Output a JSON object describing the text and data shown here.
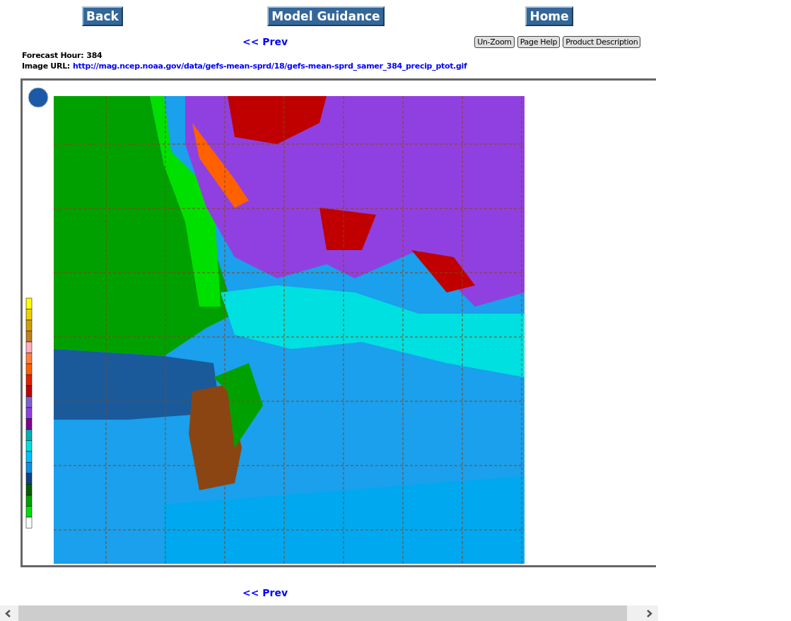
{
  "nav_buttons": [
    {
      "label": "Back"
    },
    {
      "label": "Model Guidance"
    },
    {
      "label": "Home"
    }
  ],
  "prev_link_top": "<< Prev",
  "tool_buttons": [
    {
      "label": "Un-Zoom"
    },
    {
      "label": "Page Help"
    },
    {
      "label": "Product Description"
    }
  ],
  "forecast_hour": {
    "label": "Forecast Hour:",
    "value": "384"
  },
  "image_url": {
    "label": "Image URL:",
    "url": "http://mag.ncep.noaa.gov/data/gefs-mean-sprd/18/gefs-mean-sprd_samer_384_precip_ptot.gif"
  },
  "prev_link_bottom": "<< Prev"
}
